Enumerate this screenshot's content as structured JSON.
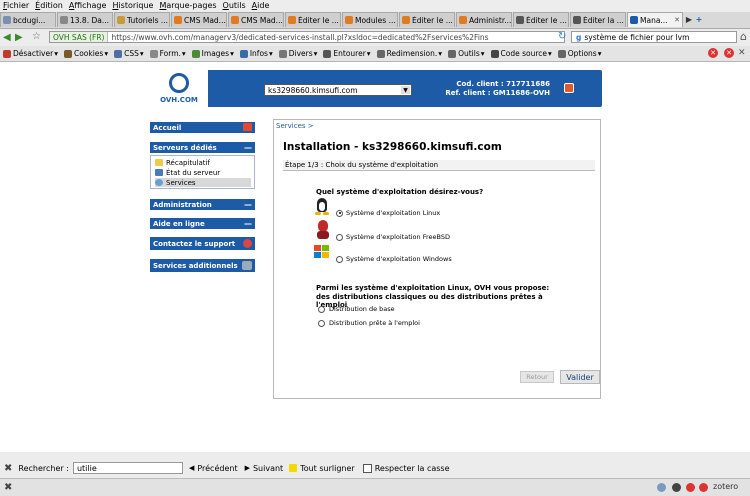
{
  "menu": [
    "Fichier",
    "Édition",
    "Affichage",
    "Historique",
    "Marque-pages",
    "Outils",
    "Aide"
  ],
  "tabs": [
    {
      "label": "bcdugi...",
      "color": "#7b8fb3"
    },
    {
      "label": "13.8. Da...",
      "color": "#888888"
    },
    {
      "label": "Tutoriels ...",
      "color": "#c79b3b"
    },
    {
      "label": "CMS Mad...",
      "color": "#e07b22"
    },
    {
      "label": "CMS Mad...",
      "color": "#e07b22"
    },
    {
      "label": "Éditer le ...",
      "color": "#e07b22"
    },
    {
      "label": "Modules ...",
      "color": "#e07b22"
    },
    {
      "label": "Éditer le ...",
      "color": "#e07b22"
    },
    {
      "label": "Administr...",
      "color": "#e07b22"
    },
    {
      "label": "Éditer le ...",
      "color": "#555555"
    },
    {
      "label": "Éditer la ...",
      "color": "#555555"
    },
    {
      "label": "Mana...",
      "color": "#1d5ba6",
      "active": true
    }
  ],
  "nav": {
    "site_label": "OVH SAS (FR)",
    "url": "https://www.ovh.com/managerv3/dedicated-services-install.pl?xsldoc=dedicated%2Fservices%2Fins",
    "search_value": "système de fichier pour lvm"
  },
  "devtools": [
    {
      "label": "Désactiver",
      "color": "#c0392b"
    },
    {
      "label": "Cookies",
      "color": "#7a5a2a"
    },
    {
      "label": "CSS",
      "color": "#4a6fa5"
    },
    {
      "label": "Form.",
      "color": "#888888"
    },
    {
      "label": "Images",
      "color": "#4a8a3a"
    },
    {
      "label": "Infos",
      "color": "#3a6aa8"
    },
    {
      "label": "Divers",
      "color": "#777777"
    },
    {
      "label": "Entourer",
      "color": "#555555"
    },
    {
      "label": "Redimension.",
      "color": "#666666"
    },
    {
      "label": "Outils",
      "color": "#666666"
    },
    {
      "label": "Code source",
      "color": "#444444"
    },
    {
      "label": "Options",
      "color": "#666666"
    }
  ],
  "header": {
    "logo_text": "OVH.COM",
    "server": "ks3298660.kimsufi.com",
    "code_label": "Cod. client :",
    "code_value": "717711686",
    "ref_label": "Ref. client :",
    "ref_value": "GM11686-OVH"
  },
  "sidebar": {
    "accueil": "Accueil",
    "serveurs": "Serveurs dédiés",
    "sub": [
      "Récapitulatif",
      "État du serveur",
      "Services"
    ],
    "administration": "Administration",
    "aide": "Aide en ligne",
    "support": "Contactez le support",
    "services_add": "Services additionnels"
  },
  "main": {
    "breadcrumb": "Services >",
    "title": "Installation - ks3298660.kimsufi.com",
    "step": "Étape 1/3 : Choix du système d'exploitation",
    "question": "Quel système d'exploitation désirez-vous?",
    "os_options": [
      {
        "label": "Système d'exploitation Linux",
        "selected": true
      },
      {
        "label": "Système d'exploitation FreeBSD",
        "selected": false
      },
      {
        "label": "Système d'exploitation Windows",
        "selected": false
      }
    ],
    "dist_question": "Parmi les système d'exploitation Linux, OVH vous propose: des distributions classiques ou des distributions prêtes à l'emploi",
    "dist_options": [
      "Distribution de base",
      "Distribution prête à l'emploi"
    ],
    "back_label": "Retour",
    "next_label": "Valider"
  },
  "findbar": {
    "label": "Rechercher :",
    "value": "utilie",
    "prev": "Précédent",
    "next": "Suivant",
    "highlight": "Tout surligner",
    "case": "Respecter la casse"
  },
  "status": {
    "zotero": "zotero"
  }
}
